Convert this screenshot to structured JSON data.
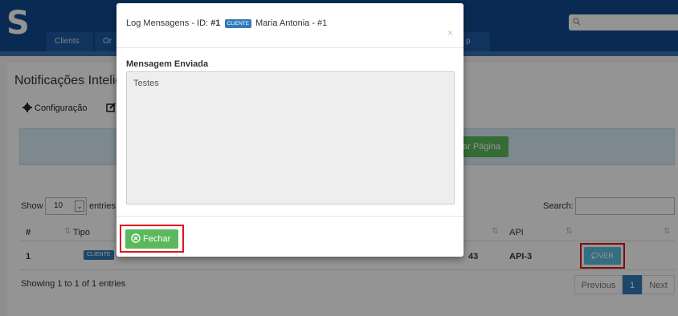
{
  "header": {
    "brand": "S",
    "nav_tabs": [
      "Clients",
      "Or",
      "p"
    ]
  },
  "page": {
    "title": "Notificações Inteligentes",
    "config_link": "Configuração",
    "green_button_label": "ar Página"
  },
  "table": {
    "show_label": "Show",
    "page_length": "10",
    "entries_label": "entries",
    "search_label": "Search:",
    "columns": [
      "#",
      "Tipo",
      "API"
    ],
    "row": {
      "id": "1",
      "tipo_badge": "CLIENTE",
      "partial": "43",
      "api": "API-3",
      "action_label": "VER"
    },
    "info": "Showing 1 to 1 of 1 entries",
    "pagination": {
      "prev": "Previous",
      "current": "1",
      "next": "Next"
    }
  },
  "modal": {
    "title_prefix": "Log Mensagens - ID:",
    "title_id": "#1",
    "title_badge": "CLIENTE",
    "title_suffix": "Maria Antonia - #1",
    "close": "×",
    "message_label": "Mensagem Enviada",
    "message_text": "Testes",
    "close_button_label": "Fechar"
  },
  "colors": {
    "nav_blue": "#114a8f",
    "badge_blue": "#337ab7",
    "success_green": "#5cb85c",
    "info_cyan": "#5bc0de",
    "highlight_red": "#e0141e"
  }
}
